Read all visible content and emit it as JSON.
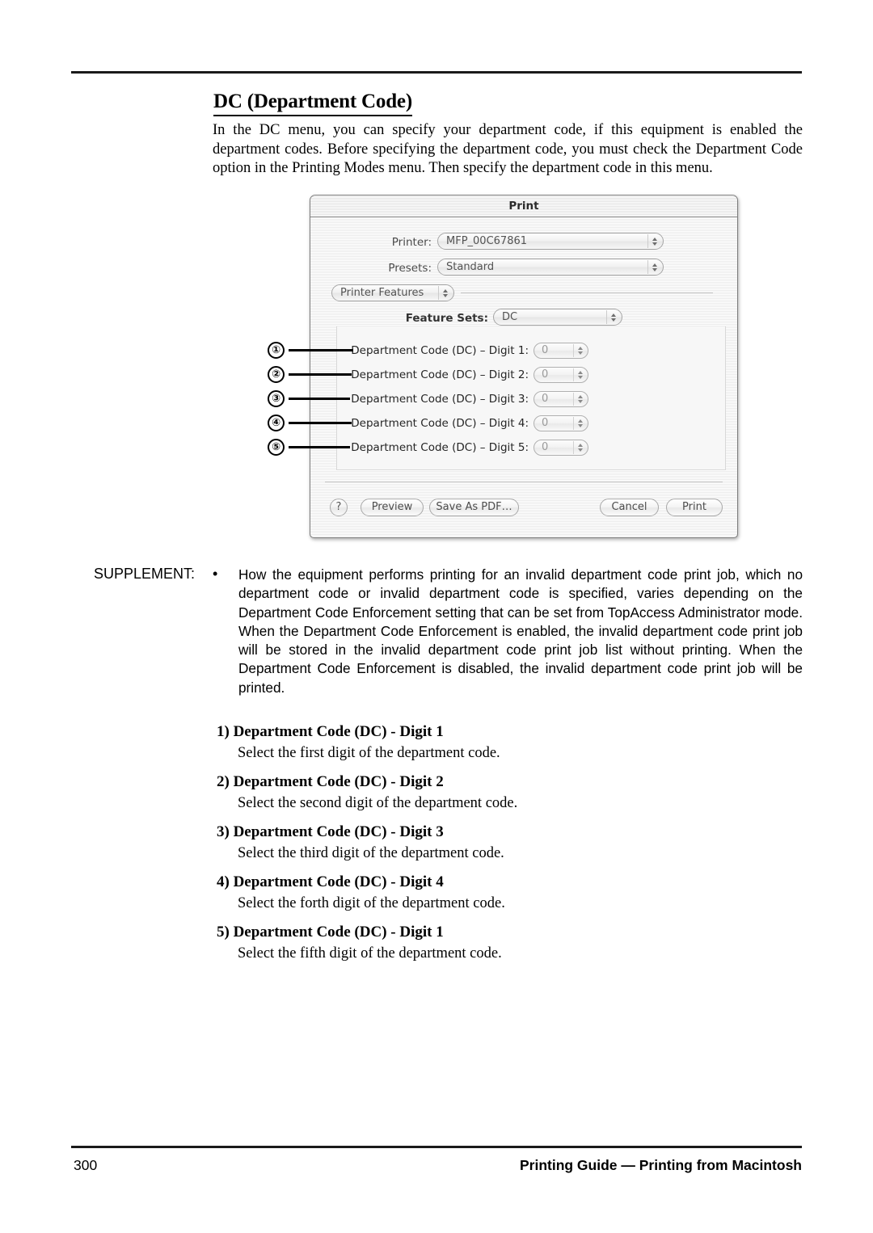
{
  "page": {
    "heading": "DC (Department Code)",
    "intro": "In the DC menu, you can specify your department code, if this equipment is enabled the department codes.  Before specifying the department code, you must check the Department Code option in the Printing Modes menu.  Then specify the department code in this menu."
  },
  "dialog": {
    "title": "Print",
    "printer_label": "Printer:",
    "printer_value": "MFP_00C67861",
    "presets_label": "Presets:",
    "presets_value": "Standard",
    "pane_popup_value": "Printer Features",
    "feature_sets_label": "Feature Sets:",
    "feature_sets_value": "DC",
    "rows": [
      {
        "label": "Department Code (DC) – Digit 1:",
        "value": "0"
      },
      {
        "label": "Department Code (DC) – Digit 2:",
        "value": "0"
      },
      {
        "label": "Department Code (DC) – Digit 3:",
        "value": "0"
      },
      {
        "label": "Department Code (DC) – Digit 4:",
        "value": "0"
      },
      {
        "label": "Department Code (DC) – Digit 5:",
        "value": "0"
      }
    ],
    "buttons": {
      "help": "?",
      "preview": "Preview",
      "save_as_pdf": "Save As PDF…",
      "cancel": "Cancel",
      "print": "Print"
    }
  },
  "callouts": [
    {
      "marker": "①"
    },
    {
      "marker": "②"
    },
    {
      "marker": "③"
    },
    {
      "marker": "④"
    },
    {
      "marker": "⑤"
    }
  ],
  "supplement": {
    "label": "SUPPLEMENT:",
    "bullet": "•",
    "text": "How the equipment performs printing for an invalid department code print job, which no department code or invalid department code is specified, varies depending on the Department Code Enforcement setting that can be set from TopAccess Administrator mode.  When the Department Code Enforcement is enabled, the invalid department code print job will be stored in the invalid department code print job list without printing.  When the Department Code Enforcement is disabled, the invalid department code print job will be printed."
  },
  "definitions": [
    {
      "term": "1) Department Code (DC) - Digit 1",
      "desc": "Select the first digit of the department code."
    },
    {
      "term": "2) Department Code (DC) - Digit 2",
      "desc": "Select the second digit of the department code."
    },
    {
      "term": "3) Department Code (DC) - Digit 3",
      "desc": "Select the third digit of the department code."
    },
    {
      "term": "4) Department Code (DC) - Digit 4",
      "desc": "Select the forth digit of the department code."
    },
    {
      "term": "5) Department Code (DC) - Digit 1",
      "desc": "Select the fifth digit of the department code."
    }
  ],
  "footer": {
    "page_number": "300",
    "title": "Printing Guide — Printing from Macintosh"
  }
}
